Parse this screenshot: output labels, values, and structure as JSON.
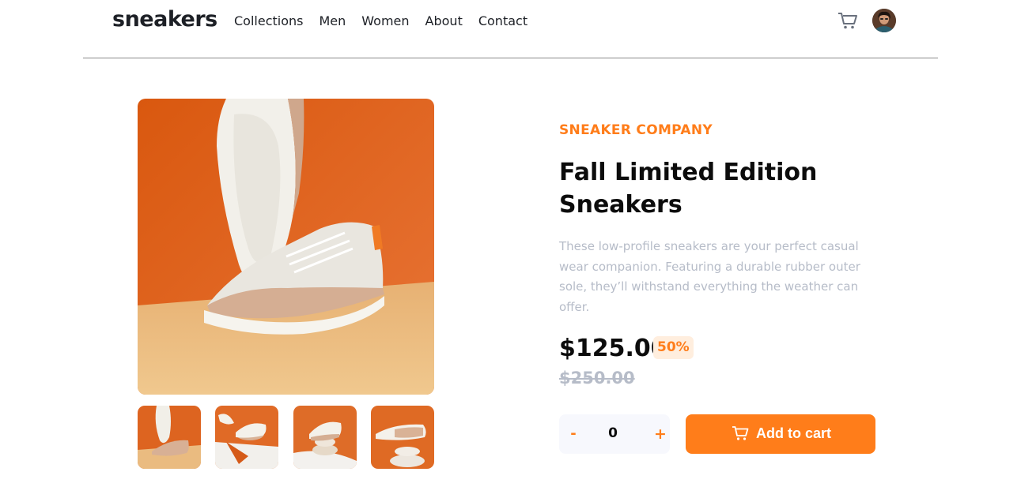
{
  "header": {
    "logo": "sneakers",
    "nav": [
      "Collections",
      "Men",
      "Women",
      "About",
      "Contact"
    ],
    "cart_icon": "cart-icon",
    "avatar_icon": "user-avatar"
  },
  "gallery": {
    "main_image": "product-image-1",
    "thumbnails": [
      "thumbnail-1",
      "thumbnail-2",
      "thumbnail-3",
      "thumbnail-4"
    ]
  },
  "product": {
    "company": "SNEAKER COMPANY",
    "title": "Fall Limited Edition Sneakers",
    "description": "These low-profile sneakers are your perfect casual wear companion. Featuring a durable rubber outer sole, they’ll withstand everything the weather can offer.",
    "price": "$125.00",
    "discount": "50%",
    "original_price": "$250.00"
  },
  "cart_controls": {
    "minus": "-",
    "quantity": "0",
    "plus": "+",
    "add_label": "Add to cart",
    "add_icon": "cart-icon"
  },
  "colors": {
    "accent": "#ff7d1a",
    "accent_pale": "#ffeede",
    "text_dark": "#1d2026",
    "text_muted": "#b6bcc8"
  }
}
